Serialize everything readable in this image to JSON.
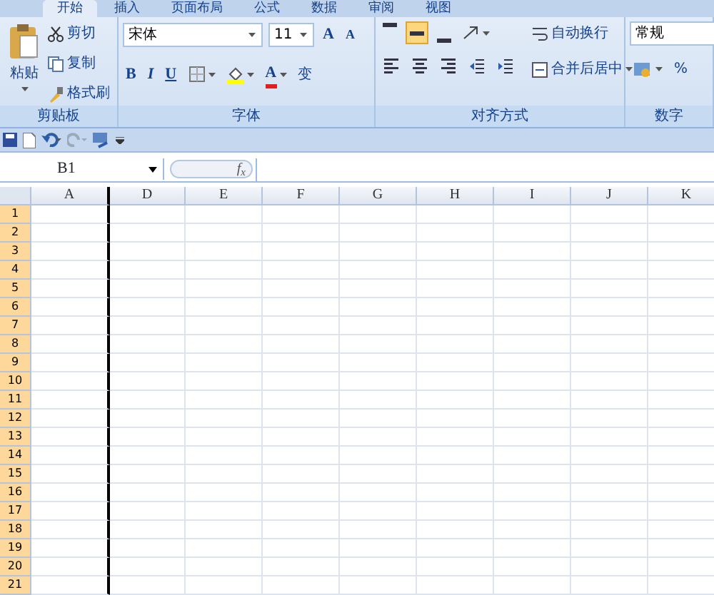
{
  "ribbon_tabs": [
    {
      "label": "开始",
      "selected": true
    },
    {
      "label": "插入",
      "selected": false
    },
    {
      "label": "页面布局",
      "selected": false
    },
    {
      "label": "公式",
      "selected": false
    },
    {
      "label": "数据",
      "selected": false
    },
    {
      "label": "审阅",
      "selected": false
    },
    {
      "label": "视图",
      "selected": false
    }
  ],
  "clipboard": {
    "paste": "粘贴",
    "items": [
      {
        "kind": "cut",
        "label": "剪切"
      },
      {
        "kind": "copy",
        "label": "复制"
      },
      {
        "kind": "brush",
        "label": "格式刷"
      }
    ],
    "label": "剪贴板"
  },
  "font": {
    "name": "宋体",
    "size": "11",
    "grow": "A",
    "shrink": "A",
    "bold": "B",
    "italic": "I",
    "underline": "U",
    "font_color": "A",
    "phonetic": "变",
    "label": "字体"
  },
  "alignment": {
    "vertical": [
      {
        "selected": false
      },
      {
        "selected": true
      },
      {
        "selected": false
      }
    ],
    "wrap": "自动换行",
    "merge": "合并后居中",
    "label": "对齐方式"
  },
  "number": {
    "format": "常规",
    "percent": "%",
    "label": "数字"
  },
  "formula_bar": {
    "name_box": "B1",
    "fx": "f$_{x}$"
  },
  "sheet": {
    "columns": [
      {
        "label": "A",
        "hidden_after": true
      },
      {
        "label": "D",
        "hidden_after": false
      },
      {
        "label": "E",
        "hidden_after": false
      },
      {
        "label": "F",
        "hidden_after": false
      },
      {
        "label": "G",
        "hidden_after": false
      },
      {
        "label": "H",
        "hidden_after": false
      },
      {
        "label": "I",
        "hidden_after": false
      },
      {
        "label": "J",
        "hidden_after": false
      },
      {
        "label": "K",
        "hidden_after": false
      }
    ],
    "rows": [
      "1",
      "2",
      "3",
      "4",
      "5",
      "6",
      "7",
      "8",
      "9",
      "10",
      "11",
      "12",
      "13",
      "14",
      "15",
      "16",
      "17",
      "18",
      "19",
      "20",
      "21"
    ],
    "rows_highlighted": true
  }
}
